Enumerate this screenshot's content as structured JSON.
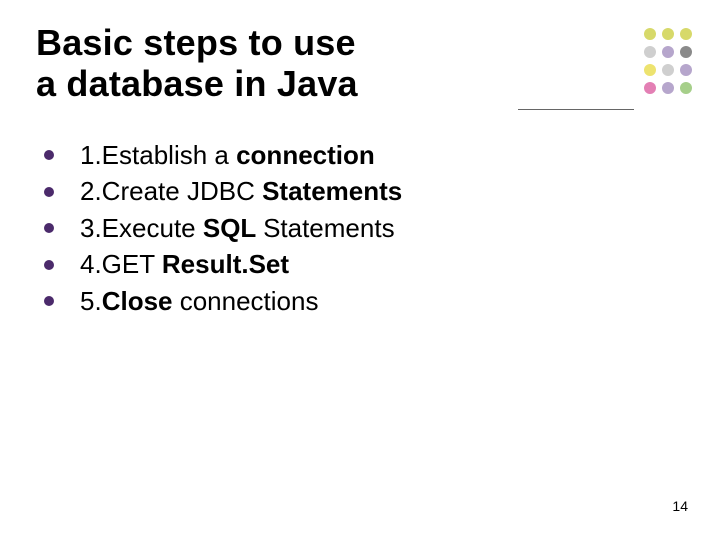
{
  "title": {
    "line1": "Basic steps to use",
    "line2": "a database in Java"
  },
  "bullets": [
    {
      "prefix": "1.Establish a ",
      "bold": "connection",
      "suffix": ""
    },
    {
      "prefix": "2.Create JDBC ",
      "bold": "Statements",
      "suffix": ""
    },
    {
      "prefix": "3.Execute ",
      "bold": "SQL ",
      "suffix": "Statements"
    },
    {
      "prefix": "4.GET ",
      "bold": "Result.Set",
      "suffix": ""
    },
    {
      "prefix": "5.",
      "bold": "Close ",
      "suffix": "connections"
    }
  ],
  "dot_colors": [
    "#d7d96a",
    "#d7d96a",
    "#d7d96a",
    "#cfcfcf",
    "#b6a6cc",
    "#8a8a8a",
    "#ede36f",
    "#cfcfcf",
    "#b6a6cc",
    "#e37fb4",
    "#b6a6cc",
    "#a6cf8a"
  ],
  "page_number": "14"
}
